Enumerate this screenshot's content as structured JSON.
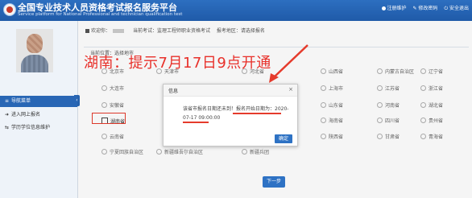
{
  "header": {
    "title": "全国专业技术人员资格考试报名服务平台",
    "subtitle": "Service platform for National Professional and technician qualification test",
    "links": [
      "注册维护",
      "修改密码",
      "安全退出"
    ]
  },
  "sidebar": {
    "items": [
      {
        "label": "导航菜单",
        "icon": "menu-icon"
      },
      {
        "label": "进入网上报名",
        "icon": "arrow-icon"
      },
      {
        "label": "学历学位信息维护",
        "icon": "share-icon"
      }
    ]
  },
  "breadcrumb": {
    "welcome": "欢迎你：",
    "exam": "当前考试：监理工程师职业资格考试",
    "status": "报考地区：请选择报名"
  },
  "location_label": "当前位置：选择地市",
  "annotation": "湖南：提示7月17日9点开通",
  "regions": [
    {
      "label": "北京市",
      "col": 0
    },
    {
      "label": "天津市",
      "col": 1
    },
    {
      "label": "河北省",
      "col": 2
    },
    {
      "label": "山西省",
      "col": 3
    },
    {
      "label": "内蒙古自治区",
      "col": 4
    },
    {
      "label": "辽宁省",
      "col": 5
    },
    {
      "label": "大连市",
      "col": 0
    },
    {
      "label": "",
      "col": 1
    },
    {
      "label": "",
      "col": 2
    },
    {
      "label": "上海市",
      "col": 3
    },
    {
      "label": "江苏省",
      "col": 4
    },
    {
      "label": "浙江省",
      "col": 5
    },
    {
      "label": "安徽省",
      "col": 0
    },
    {
      "label": "",
      "col": 1
    },
    {
      "label": "",
      "col": 2
    },
    {
      "label": "山东省",
      "col": 3
    },
    {
      "label": "河南省",
      "col": 4
    },
    {
      "label": "湖北省",
      "col": 5
    },
    {
      "label": "湖南省",
      "col": 0
    },
    {
      "label": "",
      "col": 1
    },
    {
      "label": "",
      "col": 2
    },
    {
      "label": "海南省",
      "col": 3
    },
    {
      "label": "四川省",
      "col": 4
    },
    {
      "label": "贵州省",
      "col": 5
    },
    {
      "label": "云南省",
      "col": 0
    },
    {
      "label": "",
      "col": 1
    },
    {
      "label": "",
      "col": 2
    },
    {
      "label": "陕西省",
      "col": 3
    },
    {
      "label": "甘肃省",
      "col": 4
    },
    {
      "label": "青海省",
      "col": 5
    },
    {
      "label": "宁夏回族自治区",
      "col": 0
    },
    {
      "label": "新疆维吾尔自治区",
      "col": 1
    },
    {
      "label": "新疆兵团",
      "col": 2
    }
  ],
  "modal": {
    "title": "信息",
    "close": "×",
    "message": "该省市报名日期还未到！报名开始日期为：2020-07-17 09:00:00",
    "ok": "确定"
  },
  "next_button": "下一步",
  "colors": {
    "header": "#1f5aa8",
    "accent": "#2e72c4",
    "annotation": "#e8302a"
  }
}
